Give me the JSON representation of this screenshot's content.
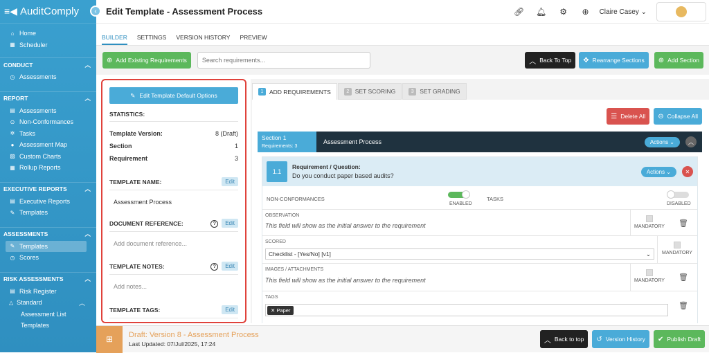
{
  "app": {
    "name": "AuditComply"
  },
  "sidebar": {
    "top": [
      {
        "label": "Home",
        "icon": "home-icon"
      },
      {
        "label": "Scheduler",
        "icon": "calendar-icon"
      }
    ],
    "sections": [
      {
        "title": "CONDUCT",
        "items": [
          {
            "label": "Assessments",
            "icon": "clock-icon"
          }
        ]
      },
      {
        "title": "REPORT",
        "items": [
          {
            "label": "Assessments",
            "icon": "list-icon"
          },
          {
            "label": "Non-Conformances",
            "icon": "circles-icon"
          },
          {
            "label": "Tasks",
            "icon": "gear-icon"
          },
          {
            "label": "Assessment Map",
            "icon": "pin-icon"
          },
          {
            "label": "Custom Charts",
            "icon": "chart-icon"
          },
          {
            "label": "Rollup Reports",
            "icon": "rollup-icon"
          }
        ]
      },
      {
        "title": "EXECUTIVE REPORTS",
        "items": [
          {
            "label": "Executive Reports",
            "icon": "list-icon"
          },
          {
            "label": "Templates",
            "icon": "edit-icon"
          }
        ]
      },
      {
        "title": "ASSESSMENTS",
        "items": [
          {
            "label": "Templates",
            "icon": "edit-icon"
          },
          {
            "label": "Scores",
            "icon": "clock-icon"
          }
        ]
      },
      {
        "title": "RISK ASSESSMENTS",
        "items": [
          {
            "label": "Risk Register",
            "icon": "list-icon"
          },
          {
            "label": "Standard",
            "icon": "warning-icon"
          },
          {
            "label": "Assessment List",
            "icon": ""
          },
          {
            "label": "Templates",
            "icon": ""
          }
        ]
      }
    ]
  },
  "header": {
    "title": "Edit Template - Assessment Process",
    "user": "Claire Casey"
  },
  "tabs": [
    "BUILDER",
    "SETTINGS",
    "VERSION HISTORY",
    "PREVIEW"
  ],
  "toolbar": {
    "add_existing": "Add Existing Requirements",
    "search_placeholder": "Search requirements...",
    "back_to_top": "Back To Top",
    "rearrange": "Rearrange Sections",
    "add_section": "Add Section"
  },
  "left": {
    "edit_defaults": "Edit Template Default Options",
    "statistics": "STATISTICS:",
    "stats": [
      {
        "label": "Template Version:",
        "value": "8 (Draft)"
      },
      {
        "label": "Section",
        "value": "1"
      },
      {
        "label": "Requirement",
        "value": "3"
      }
    ],
    "template_name_label": "TEMPLATE NAME:",
    "template_name": "Assessment Process",
    "doc_ref_label": "DOCUMENT REFERENCE:",
    "doc_ref_placeholder": "Add document reference...",
    "notes_label": "TEMPLATE NOTES:",
    "notes_placeholder": "Add notes...",
    "tags_label": "TEMPLATE TAGS:",
    "edit": "Edit"
  },
  "right": {
    "tabs": [
      {
        "num": "1",
        "label": "ADD REQUIREMENTS"
      },
      {
        "num": "2",
        "label": "SET SCORING"
      },
      {
        "num": "3",
        "label": "SET GRADING"
      }
    ],
    "delete_all": "Delete All",
    "collapse_all": "Collapse All",
    "section": {
      "name": "Section 1",
      "count": "Requirements: 3",
      "title": "Assessment Process",
      "actions": "Actions"
    },
    "requirement": {
      "num": "1.1",
      "label": "Requirement / Question:",
      "question": "Do you conduct paper based audits?",
      "actions": "Actions",
      "nc_label": "NON-CONFORMANCES",
      "nc_state": "ENABLED",
      "tasks_label": "TASKS",
      "tasks_state": "DISABLED",
      "obs_label": "OBSERVATION",
      "obs_text": "This field will show as the initial answer to the requirement",
      "scored_label": "SCORED",
      "scored_value": "Checklist - [Yes/No] [v1]",
      "img_label": "IMAGES / ATTACHMENTS",
      "img_text": "This field will show as the initial answer to the requirement",
      "tags_label": "TAGS",
      "tag": "Paper",
      "mandatory": "MANDATORY"
    }
  },
  "bottom": {
    "title": "Draft: Version 8 - Assessment Process",
    "updated": "Last Updated: 07/Jul/2025, 17:24",
    "back_to_top": "Back to top",
    "version_history": "Version History",
    "publish": "Publish Draft"
  }
}
